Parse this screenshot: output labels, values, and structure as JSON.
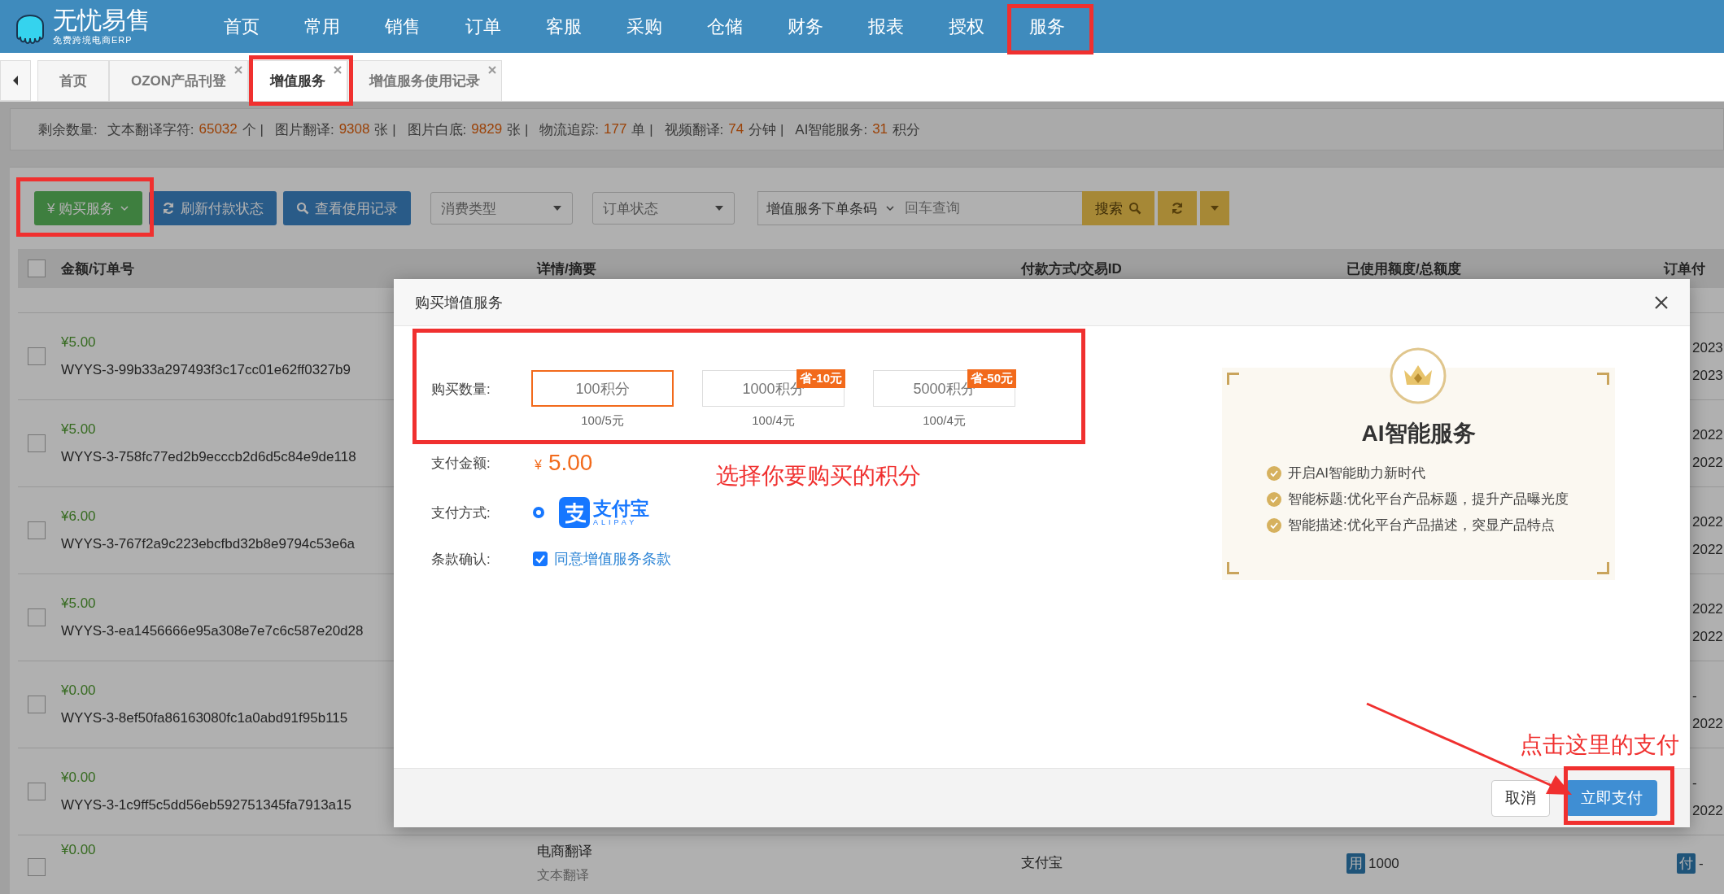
{
  "brand": {
    "name": "无忧易售",
    "tagline": "免费跨境电商ERP"
  },
  "nav": [
    "首页",
    "常用",
    "销售",
    "订单",
    "客服",
    "采购",
    "仓储",
    "财务",
    "报表",
    "授权",
    "服务"
  ],
  "tabs": [
    {
      "label": "首页",
      "selected": false,
      "closable": false
    },
    {
      "label": "OZON产品刊登",
      "selected": false,
      "closable": true
    },
    {
      "label": "增值服务",
      "selected": true,
      "closable": true
    },
    {
      "label": "增值服务使用记录",
      "selected": false,
      "closable": true
    }
  ],
  "summary": {
    "label": "剩余数量:",
    "items": [
      {
        "label": "文本翻译字符:",
        "value": "65032",
        "unit": "个 |"
      },
      {
        "label": "图片翻译:",
        "value": "9308",
        "unit": "张 |"
      },
      {
        "label": "图片白底:",
        "value": "9829",
        "unit": "张 |"
      },
      {
        "label": "物流追踪:",
        "value": "177",
        "unit": "单 |"
      },
      {
        "label": "视频翻译:",
        "value": "74",
        "unit": "分钟 |"
      },
      {
        "label": "AI智能服务:",
        "value": "31",
        "unit": "积分"
      }
    ]
  },
  "toolbar": {
    "buy": "¥ 购买服务",
    "refresh": "刷新付款状态",
    "history": "查看使用记录",
    "filters": [
      "消费类型",
      "订单状态"
    ],
    "search": {
      "scope": "增值服务下单条码",
      "placeholder": "回车查询",
      "button": "搜索"
    }
  },
  "table": {
    "select_all_checked": false,
    "columns": [
      "金额/订单号",
      "详情/摘要",
      "付款方式/交易ID",
      "已使用额度/总额度",
      "订单付"
    ],
    "rows": [
      {
        "checked": false,
        "amount": "¥5.00",
        "order": "WYYS-3-99b33a297493f3c17cc01e62ff0327b9",
        "dates": [
          "2023",
          "2023"
        ]
      },
      {
        "checked": false,
        "amount": "¥5.00",
        "order": "WYYS-3-758fc77ed2b9ecccb2d6d5c84e9de118",
        "dates": [
          "2022",
          "2022"
        ]
      },
      {
        "checked": false,
        "amount": "¥6.00",
        "order": "WYYS-3-767f2a9c223ebcfbd32b8e9794c53e6a",
        "dates": [
          "2022",
          "2022"
        ]
      },
      {
        "checked": false,
        "amount": "¥5.00",
        "order": "WYYS-3-ea1456666e95a308e7e7c6c587e20d28",
        "dates": [
          "2022",
          "2022"
        ]
      },
      {
        "checked": false,
        "amount": "¥0.00",
        "order": "WYYS-3-8ef50fa86163080fc1a0abd91f95b115",
        "dates": [
          "-",
          "2022"
        ]
      },
      {
        "checked": false,
        "amount": "¥0.00",
        "order": "WYYS-3-1c9ff5c5dd56eb592751345fa7913a15",
        "dates": [
          "-",
          "2022"
        ]
      }
    ],
    "last_row": {
      "checked": false,
      "amount": "¥0.00",
      "detail": "电商翻译",
      "detail_sub": "文本翻译",
      "payment": "支付宝",
      "used_badge": "用",
      "used": "1000",
      "pay_badge": "付",
      "pay": "-"
    }
  },
  "dialog": {
    "title": "购买增值服务",
    "quantity_label": "购买数量:",
    "options": [
      {
        "label": "100积分",
        "price": "100/5元",
        "selected": true
      },
      {
        "label": "1000积分",
        "price": "100/4元",
        "selected": false,
        "badge": "省-10元"
      },
      {
        "label": "5000积分",
        "price": "100/4元",
        "selected": false,
        "badge": "省-50元"
      }
    ],
    "amount_label": "支付金额:",
    "currency": "¥",
    "amount": "5.00",
    "method_label": "支付方式:",
    "method": {
      "name": "支付宝",
      "sub": "ALIPAY",
      "selected": true
    },
    "terms_label": "条款确认:",
    "terms": {
      "label": "同意增值服务条款",
      "checked": true
    },
    "promo": {
      "title": "AI智能服务",
      "features": [
        "开启AI智能助力新时代",
        "智能标题:优化平台产品标题，提升产品曝光度",
        "智能描述:优化平台产品描述，突显产品特点"
      ]
    },
    "cancel": "取消",
    "confirm": "立即支付"
  },
  "annotations": {
    "select_hint": "选择你要购买的积分",
    "pay_hint": "点击这里的支付"
  }
}
